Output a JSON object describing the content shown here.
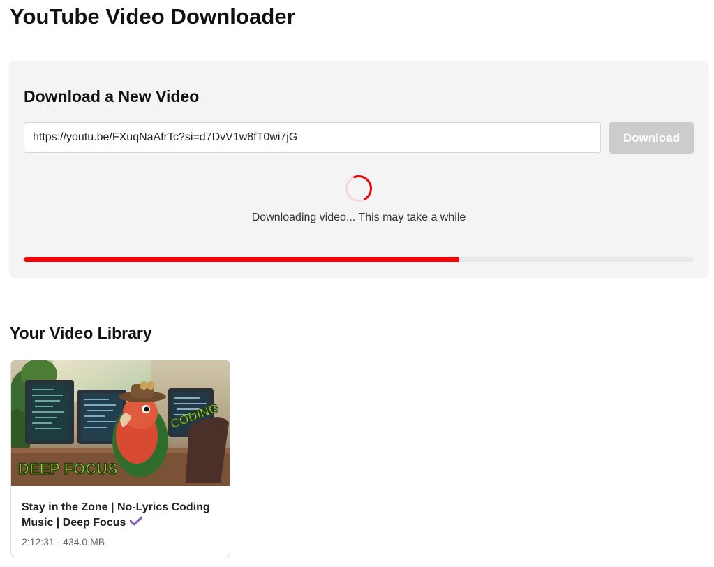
{
  "app": {
    "title": "YouTube Video Downloader"
  },
  "download": {
    "heading": "Download a New Video",
    "url_value": "https://youtu.be/FXuqNaAfrTc?si=d7DvV1w8fT0wi7jG",
    "button_label": "Download",
    "button_disabled": true,
    "status_text": "Downloading video... This may take a while",
    "progress_percent": 65,
    "accent_color": "#ff0000"
  },
  "library": {
    "heading": "Your Video Library",
    "videos": [
      {
        "title": "Stay in the Zone | No-Lyrics Coding Music | Deep Focus",
        "duration": "2:12:31",
        "size": "434.0 MB",
        "meta_separator": " · ",
        "verified_icon": "check-icon",
        "thumbnail": {
          "overlay_text_left": "DEEP FOCUS",
          "overlay_text_right": "CODING"
        }
      }
    ]
  }
}
